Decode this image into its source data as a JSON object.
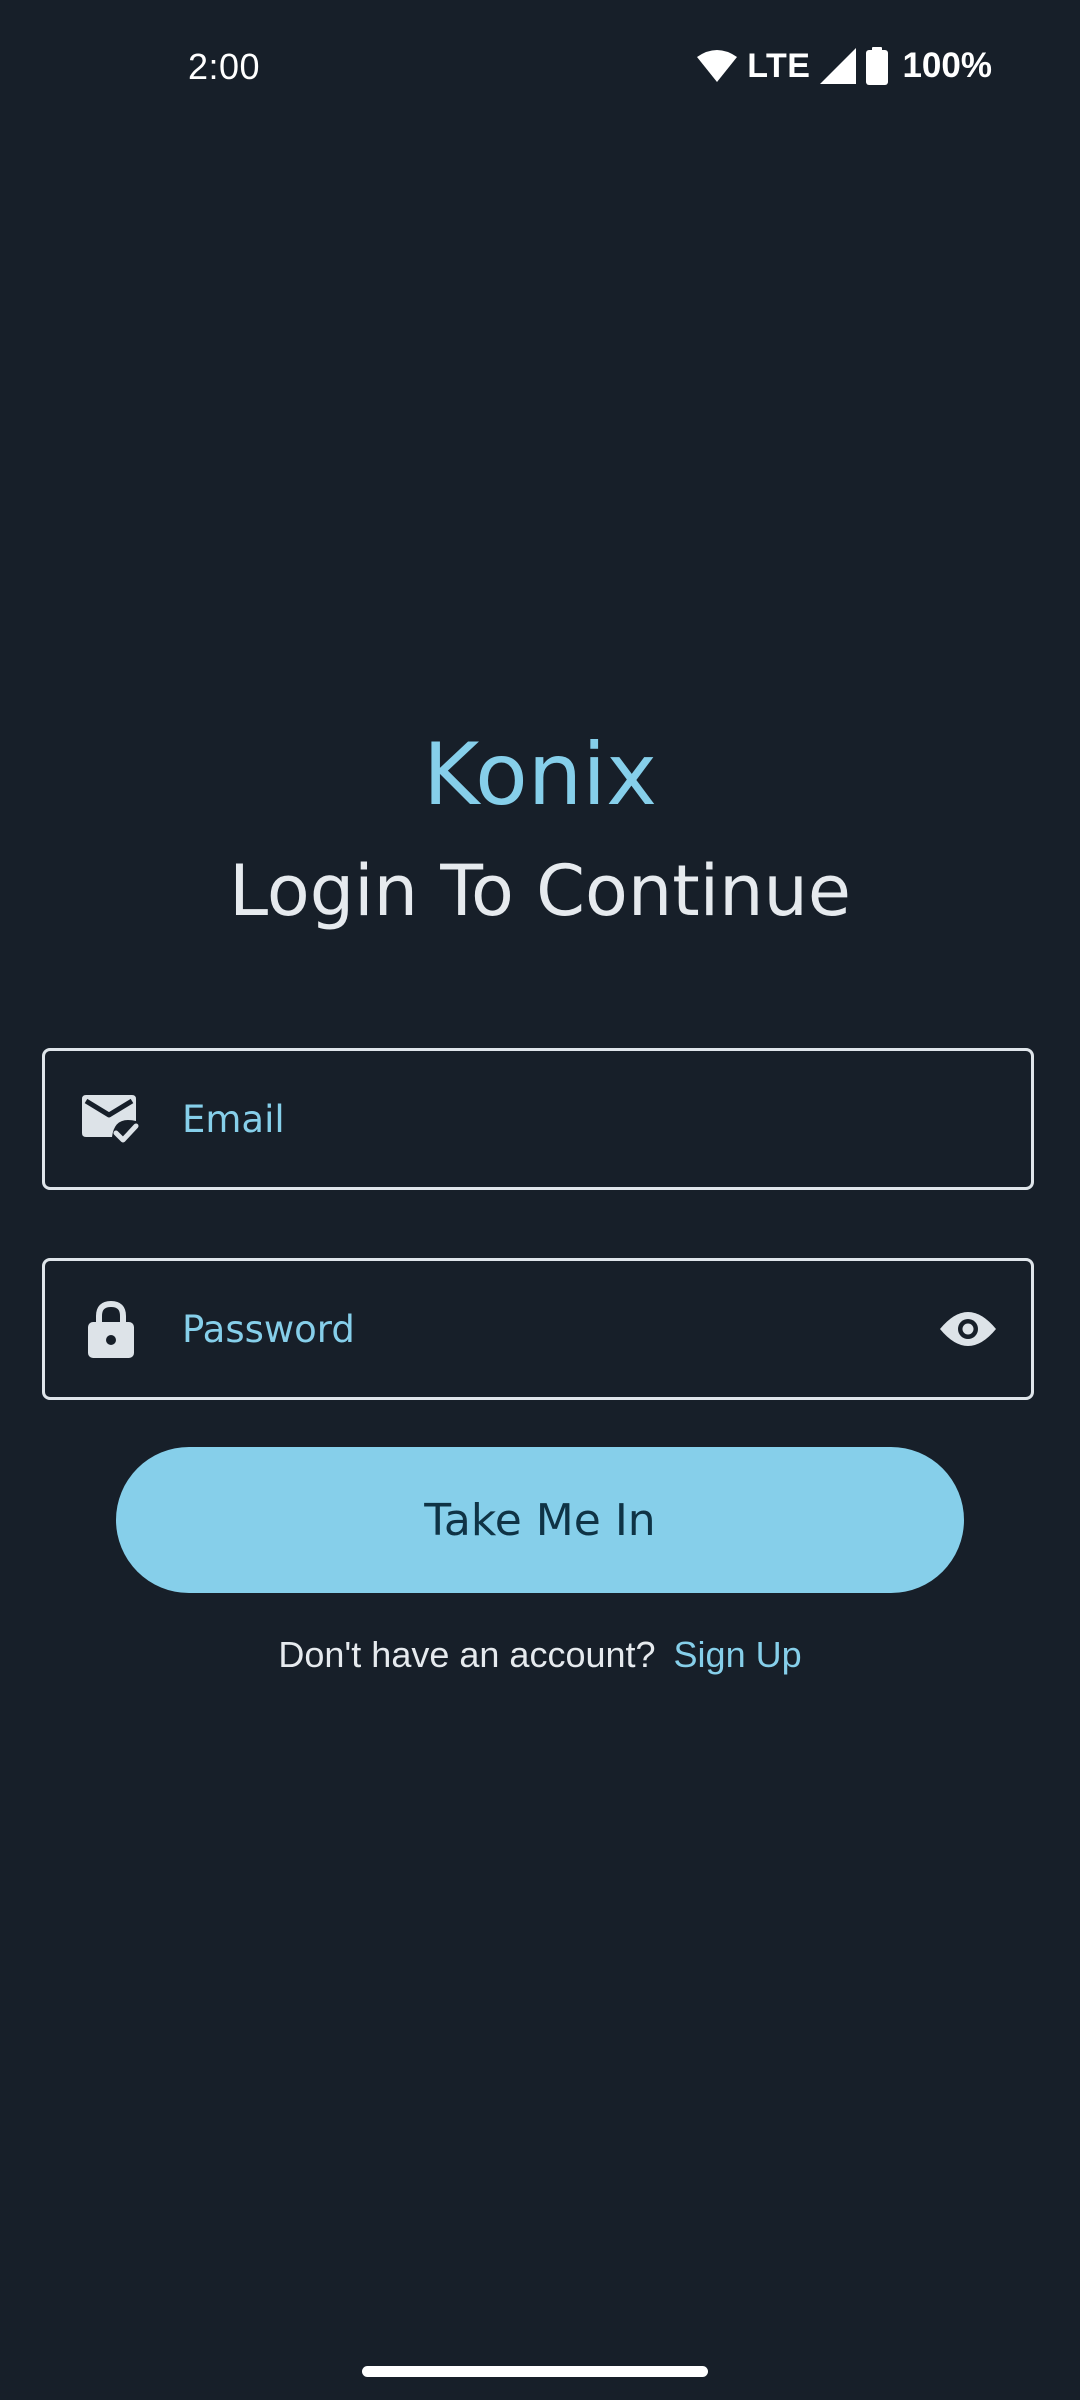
{
  "status_bar": {
    "time": "2:00",
    "network": "LTE",
    "battery": "100%"
  },
  "app": {
    "title": "Konix",
    "subtitle": "Login To Continue"
  },
  "form": {
    "email": {
      "placeholder": "Email",
      "value": "",
      "icon": "mark-email-read-icon"
    },
    "password": {
      "placeholder": "Password",
      "value": "",
      "icon": "lock-icon",
      "toggle_icon": "visibility-eye-icon"
    },
    "submit_label": "Take Me In"
  },
  "signup": {
    "prompt": "Don't have an account?",
    "link_label": "Sign Up"
  },
  "colors": {
    "background": "#171f29",
    "accent": "#86cfea",
    "text": "#e6eaee",
    "button_text": "#0f3345"
  }
}
